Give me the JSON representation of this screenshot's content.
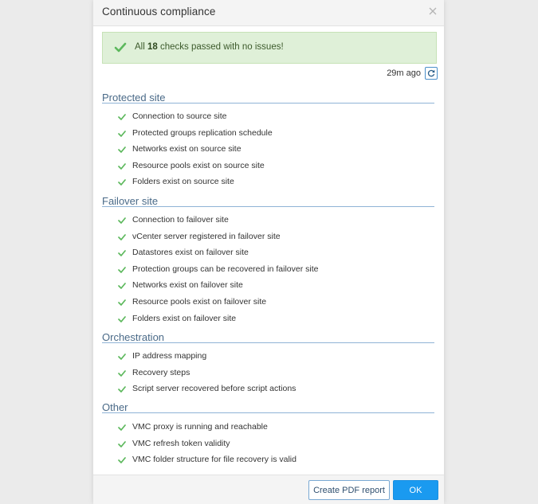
{
  "dialog": {
    "title": "Continuous compliance",
    "close_icon": "close-icon"
  },
  "banner": {
    "prefix": "All",
    "count": "18",
    "suffix": "checks passed with no issues!",
    "icon": "check-icon",
    "bg_color": "#dff0d8"
  },
  "refresh": {
    "timestamp": "29m ago",
    "icon": "refresh-icon"
  },
  "colors": {
    "check": "#5cb85c",
    "accent": "#1a9af0",
    "section_rule": "#8fb3d6"
  },
  "sections": [
    {
      "title": "Protected site",
      "items": [
        "Connection to source site",
        "Protected groups replication schedule",
        "Networks exist on source site",
        "Resource pools exist on source site",
        "Folders exist on source site"
      ]
    },
    {
      "title": "Failover site",
      "items": [
        "Connection to failover site",
        "vCenter server registered in failover site",
        "Datastores exist on failover site",
        "Protection groups can be recovered in failover site",
        "Networks exist on failover site",
        "Resource pools exist on failover site",
        "Folders exist on failover site"
      ]
    },
    {
      "title": "Orchestration",
      "items": [
        "IP address mapping",
        "Recovery steps",
        "Script server recovered before script actions"
      ]
    },
    {
      "title": "Other",
      "items": [
        "VMC proxy is running and reachable",
        "VMC refresh token validity",
        "VMC folder structure for file recovery is valid"
      ]
    }
  ],
  "footer": {
    "pdf_label": "Create PDF report",
    "ok_label": "OK"
  }
}
